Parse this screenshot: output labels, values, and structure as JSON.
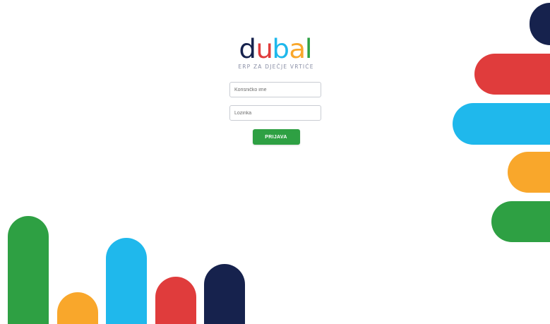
{
  "logo": {
    "letters": [
      {
        "char": "d",
        "color": "#16224d"
      },
      {
        "char": "u",
        "color": "#e03c3c"
      },
      {
        "char": "b",
        "color": "#1fb8ec"
      },
      {
        "char": "a",
        "color": "#f9a72b"
      },
      {
        "char": "l",
        "color": "#2ea043"
      }
    ],
    "tagline": "ERP ZA DJEČJE VRTIĆE"
  },
  "form": {
    "username_placeholder": "Korisničko ime",
    "password_placeholder": "Lozinka",
    "login_label": "PRIJAVA"
  },
  "colors": {
    "navy": "#16224d",
    "red": "#e03c3c",
    "blue": "#1fb8ec",
    "orange": "#f9a72b",
    "green": "#2ea043"
  }
}
